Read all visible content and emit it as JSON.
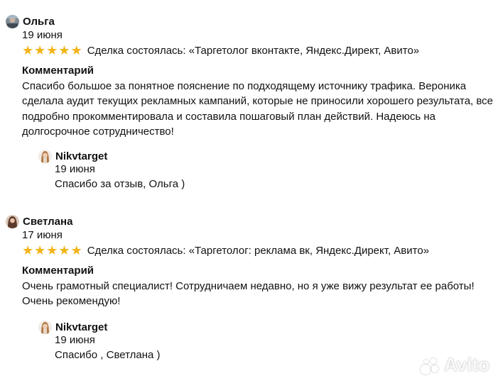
{
  "reviews": [
    {
      "author": "Ольга",
      "date": "19 июня",
      "rating": 5,
      "deal": "Сделка состоялась: «Таргетолог вконтакте, Яндекс.Директ, Авито»",
      "comment_heading": "Комментарий",
      "comment": "Спасибо большое за понятное пояснение по подходящему источнику трафика. Вероника сделала аудит текущих рекламных кампаний, которые не приносили хорошего результата, все подробно прокомментировала и составила пошаговый план действий. Надеюсь на долгосрочное сотрудничество!",
      "reply": {
        "author": "Nikvtarget",
        "date": "19 июня",
        "text": "Спасибо за отзыв, Ольга )"
      }
    },
    {
      "author": "Светлана",
      "date": "17 июня",
      "rating": 5,
      "deal": "Сделка состоялась: «Таргетолог: реклама вк, Яндекс.Директ, Авито»",
      "comment_heading": "Комментарий",
      "comment": "Очень грамотный специалист! Сотрудничаем недавно, но я уже вижу результат ее работы! Очень рекомендую!",
      "reply": {
        "author": "Nikvtarget",
        "date": "19 июня",
        "text": "Спасибо , Светлана )"
      }
    }
  ],
  "watermark": "Avito",
  "colors": {
    "star": "#f2b316",
    "text": "#111111"
  }
}
